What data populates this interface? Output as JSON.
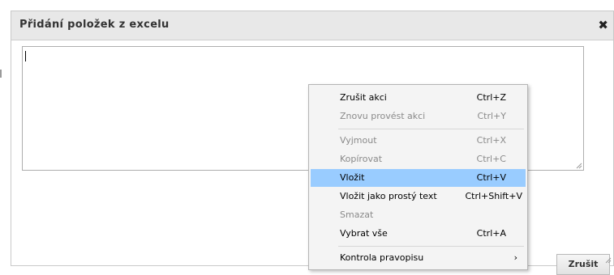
{
  "dialog": {
    "title": "Přidání položek z excelu",
    "close_icon": "✖",
    "cancel_label": "Zrušit"
  },
  "context_menu": {
    "items": [
      {
        "label": "Zrušit akci",
        "shortcut": "Ctrl+Z",
        "state": "enabled"
      },
      {
        "label": "Znovu provést akci",
        "shortcut": "Ctrl+Y",
        "state": "disabled"
      },
      {
        "label": "Vyjmout",
        "shortcut": "Ctrl+X",
        "state": "disabled"
      },
      {
        "label": "Kopírovat",
        "shortcut": "Ctrl+C",
        "state": "disabled"
      },
      {
        "label": "Vložit",
        "shortcut": "Ctrl+V",
        "state": "highlighted"
      },
      {
        "label": "Vložit jako prostý text",
        "shortcut": "Ctrl+Shift+V",
        "state": "enabled"
      },
      {
        "label": "Smazat",
        "shortcut": "",
        "state": "disabled"
      },
      {
        "label": "Vybrat vše",
        "shortcut": "Ctrl+A",
        "state": "enabled"
      },
      {
        "label": "Kontrola pravopisu",
        "shortcut": "",
        "state": "enabled",
        "submenu_arrow": "›"
      }
    ]
  },
  "colors": {
    "titlebar": "#e8e8e8",
    "highlight": "#99ccff",
    "disabled_text": "#8a8a8a"
  }
}
